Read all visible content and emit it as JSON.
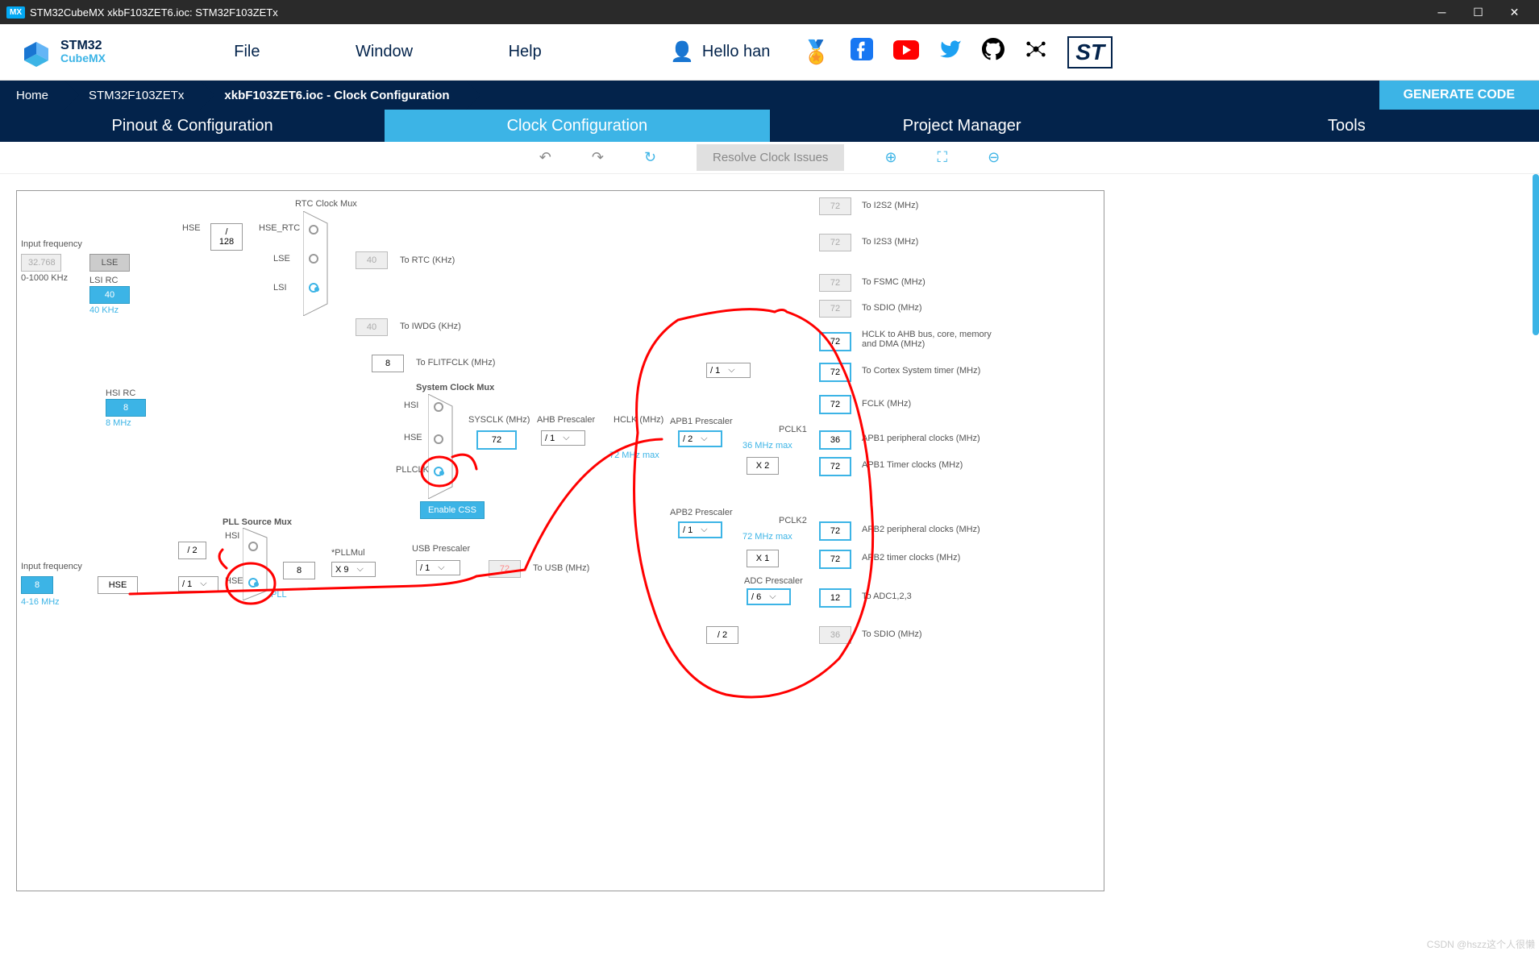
{
  "titlebar": {
    "app": "STM32CubeMX xkbF103ZET6.ioc: STM32F103ZETx"
  },
  "menu": {
    "file": "File",
    "window": "Window",
    "help": "Help",
    "user": "Hello han"
  },
  "breadcrumb": {
    "home": "Home",
    "device": "STM32F103ZETx",
    "file": "xkbF103ZET6.ioc - Clock Configuration",
    "generate": "GENERATE CODE"
  },
  "tabs": {
    "pinout": "Pinout & Configuration",
    "clock": "Clock Configuration",
    "project": "Project Manager",
    "tools": "Tools"
  },
  "toolbar": {
    "resolve": "Resolve Clock Issues"
  },
  "clock": {
    "input_freq_label": "Input frequency",
    "lse_freq": "32.768",
    "lse_range": "0-1000 KHz",
    "lse": "LSE",
    "lsi_rc": "LSI RC",
    "lsi_val": "40",
    "lsi_hz": "40 KHz",
    "hsi_rc": "HSI RC",
    "hsi_val": "8",
    "hsi_hz": "8 MHz",
    "hse_freq": "8",
    "hse_range": "4-16 MHz",
    "hse": "HSE",
    "div128": "/ 128",
    "div2": "/ 2",
    "div1_presc": "/ 1",
    "hse_lbl": "HSE",
    "hse_rtc": "HSE_RTC",
    "lse_lbl": "LSE",
    "lsi_lbl": "LSI",
    "rtc_mux": "RTC Clock Mux",
    "to_rtc": "To RTC (KHz)",
    "rtc_val": "40",
    "to_iwdg": "To IWDG (KHz)",
    "iwdg_val": "40",
    "to_flitf": "To FLITFCLK (MHz)",
    "flitf_val": "8",
    "sys_mux": "System Clock Mux",
    "hsi_mux": "HSI",
    "hse_mux": "HSE",
    "pllclk_mux": "PLLCLK",
    "enable_css": "Enable CSS",
    "sysclk_lbl": "SYSCLK (MHz)",
    "sysclk_val": "72",
    "ahb_presc": "AHB Prescaler",
    "ahb_val": "/ 1",
    "ahb_max": "72 MHz max",
    "hclk_lbl": "HCLK (MHz)",
    "pll_src_mux": "PLL Source Mux",
    "pll_hsi": "HSI",
    "pll_hse": "HSE",
    "pll_lbl": "PLL",
    "pll_in": "8",
    "pllmul_lbl": "*PLLMul",
    "pllmul": "X 9",
    "usb_presc": "USB Prescaler",
    "usb_div": "/ 1",
    "to_usb": "To USB (MHz)",
    "usb_val": "72",
    "apb1_presc": "APB1 Prescaler",
    "apb1_div": "/ 2",
    "pclk1": "PCLK1",
    "pclk1_max": "36 MHz max",
    "apb1_x": "X 2",
    "apb2_presc": "APB2 Prescaler",
    "apb2_div": "/ 1",
    "pclk2": "PCLK2",
    "pclk2_max": "72 MHz max",
    "apb2_x": "X 1",
    "adc_presc": "ADC Prescaler",
    "adc_div": "/ 6",
    "sdio_div": "/ 2",
    "out_i2s2": "72",
    "out_i2s2_lbl": "To I2S2 (MHz)",
    "out_i2s3": "72",
    "out_i2s3_lbl": "To I2S3 (MHz)",
    "out_fsmc": "72",
    "out_fsmc_lbl": "To FSMC (MHz)",
    "out_sdio1": "72",
    "out_sdio1_lbl": "To SDIO (MHz)",
    "out_hclk": "72",
    "out_hclk_lbl": "HCLK to AHB bus, core, memory and DMA (MHz)",
    "cortex_div": "/ 1",
    "out_cortex": "72",
    "out_cortex_lbl": "To Cortex System timer (MHz)",
    "out_fclk": "72",
    "out_fclk_lbl": "FCLK (MHz)",
    "out_apb1_periph": "36",
    "out_apb1_periph_lbl": "APB1 peripheral clocks (MHz)",
    "out_apb1_timer": "72",
    "out_apb1_timer_lbl": "APB1 Timer clocks (MHz)",
    "out_apb2_periph": "72",
    "out_apb2_periph_lbl": "APB2 peripheral clocks (MHz)",
    "out_apb2_timer": "72",
    "out_apb2_timer_lbl": "APB2 timer clocks (MHz)",
    "out_adc": "12",
    "out_adc_lbl": "To ADC1,2,3",
    "out_sdio2": "36",
    "out_sdio2_lbl": "To SDIO (MHz)"
  },
  "watermark": "CSDN @hszz这个人很懒"
}
